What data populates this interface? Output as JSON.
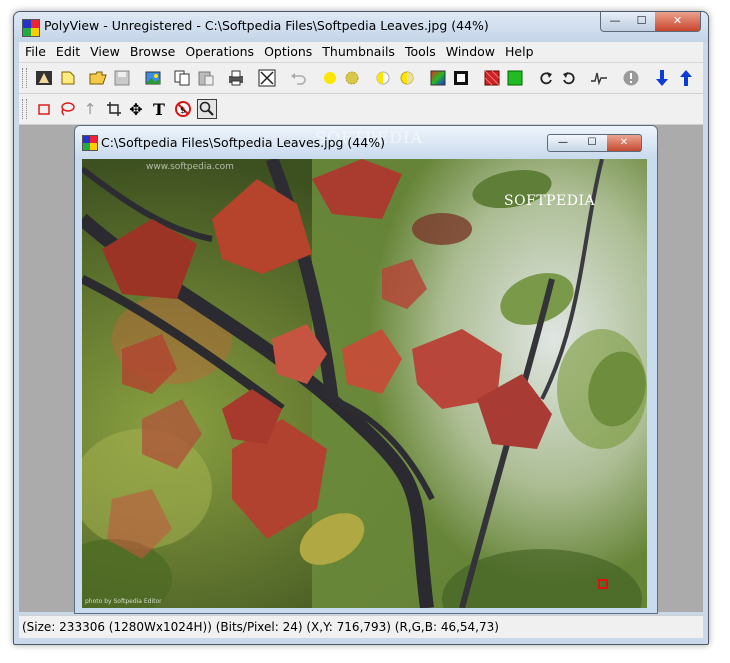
{
  "window": {
    "title": "PolyView - Unregistered - C:\\Softpedia Files\\Softpedia Leaves.jpg (44%)",
    "min_glyph": "—",
    "max_glyph": "☐",
    "close_glyph": "✕"
  },
  "menu": {
    "items": [
      "File",
      "Edit",
      "View",
      "Browse",
      "Operations",
      "Options",
      "Thumbnails",
      "Tools",
      "Window",
      "Help"
    ]
  },
  "toolbar1": {
    "icons": [
      "acquire-icon",
      "new-icon",
      "open-folder-icon",
      "save-icon",
      "image-icon",
      "copy-icon",
      "paste-icon",
      "print-icon",
      "fit-icon",
      "undo-icon",
      "brightness-up-icon",
      "brightness-down-icon",
      "contrast-up-icon",
      "contrast-down-icon",
      "color-balance-icon",
      "invert-icon",
      "red-channel-icon",
      "green-channel-icon",
      "rotate-right-icon",
      "rotate-left-icon",
      "histogram-icon",
      "info-icon",
      "arrow-down-icon",
      "arrow-up-icon"
    ]
  },
  "toolbar2": {
    "icons": [
      "rect-select-icon",
      "lasso-select-icon",
      "arrow-tool-icon",
      "crop-tool-icon",
      "move-tool-icon",
      "text-tool-icon",
      "no-tool-icon",
      "zoom-tool-icon"
    ],
    "text_tool_glyph": "T",
    "move_tool_glyph": "✥",
    "arrow_tool_glyph": "↑"
  },
  "child_window": {
    "title": "C:\\Softpedia Files\\Softpedia Leaves.jpg (44%)",
    "watermark_header": "SOFTPEDIA",
    "min_glyph": "—",
    "max_glyph": "☐",
    "close_glyph": "✕"
  },
  "image": {
    "watermark_url": "www.softpedia.com",
    "watermark_brand": "SOFTPEDIA",
    "watermark_credit": "photo by Softpedia Editor"
  },
  "status": {
    "text": "(Size: 233306 (1280Wx1024H)) (Bits/Pixel: 24) (X,Y: 716,793) (R,G,B: 46,54,73)"
  },
  "colors": {
    "titlebar": "#c4d5e8",
    "close_button": "#c9462c",
    "mdi_background": "#ababab",
    "toolbar_bg": "#f0f0f0",
    "arrow_blue": "#0a3cd8",
    "yellow": "#ffe600"
  }
}
